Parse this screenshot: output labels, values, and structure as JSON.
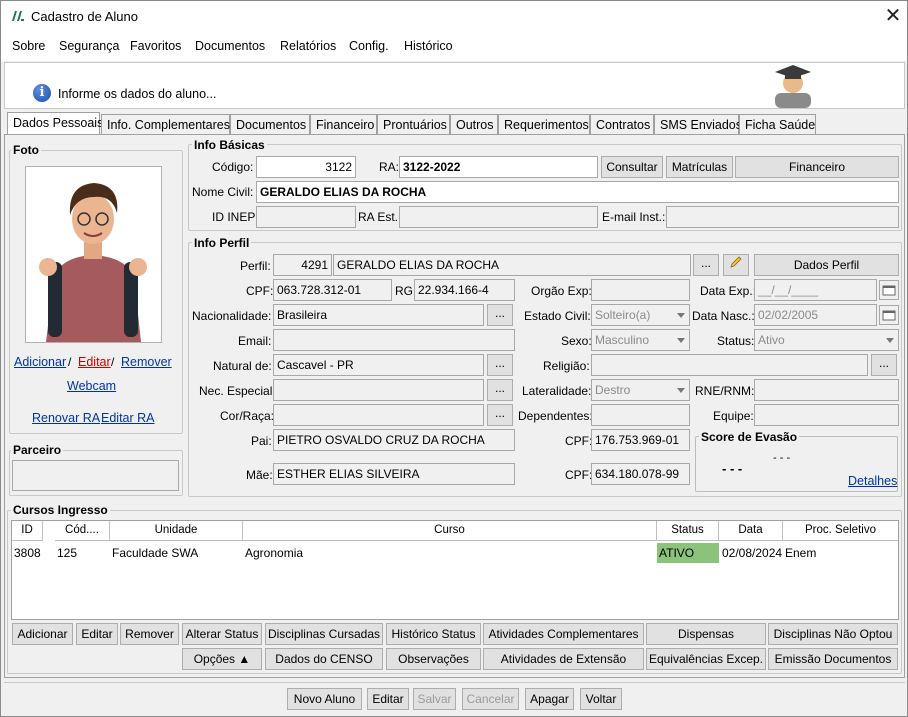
{
  "window": {
    "title": "Cadastro de Aluno"
  },
  "menu": [
    "Sobre",
    "Segurança",
    "Favoritos",
    "Documentos",
    "Relatórios",
    "Config.",
    "Histórico"
  ],
  "info_message": "Informe os dados do aluno...",
  "tabs": [
    "Dados Pessoais",
    "Info. Complementares",
    "Documentos",
    "Financeiro",
    "Prontuários",
    "Outros",
    "Requerimentos",
    "Contratos",
    "SMS Enviados",
    "Ficha Saúde"
  ],
  "foto": {
    "label": "Foto",
    "adicionar": "Adicionar",
    "editar": "Editar",
    "remover": "Remover",
    "sep": "/",
    "webcam": "Webcam",
    "renovar_ra": "Renovar RA",
    "editar_ra": "Editar RA"
  },
  "parceiro": {
    "label": "Parceiro"
  },
  "info_basicas": {
    "label": "Info Básicas",
    "codigo_label": "Código:",
    "codigo": "3122",
    "ra_label": "RA:",
    "ra": "3122-2022",
    "consultar": "Consultar",
    "matriculas": "Matrículas",
    "financeiro": "Financeiro",
    "nome_label": "Nome Civil:",
    "nome": "GERALDO ELIAS DA ROCHA",
    "inep_label": "ID INEP:",
    "ra_est_label": "RA Est.:",
    "email_inst_label": "E-mail Inst.:"
  },
  "info_perfil": {
    "label": "Info Perfil",
    "perfil_label": "Perfil:",
    "perfil_id": "4291",
    "perfil_nome": "GERALDO ELIAS DA ROCHA",
    "dados_perfil": "Dados Perfil",
    "cpf_label": "CPF:",
    "cpf": "063.728.312-01",
    "rg_label": "RG:",
    "rg": "22.934.166-4",
    "orgao_label": "Orgão Exp:",
    "data_exp_label": "Data Exp.:",
    "data_exp": "__/__/____",
    "nac_label": "Nacionalidade:",
    "nac": "Brasileira",
    "estado_civil_label": "Estado Civil:",
    "estado_civil": "Solteiro(a)",
    "data_nasc_label": "Data Nasc.:",
    "data_nasc": "02/02/2005",
    "email_label": "Email:",
    "sexo_label": "Sexo:",
    "sexo": "Masculino",
    "status_label": "Status:",
    "status": "Ativo",
    "natural_label": "Natural de:",
    "natural": "Cascavel - PR",
    "religiao_label": "Religião:",
    "nec_label": "Nec. Especial:",
    "lat_label": "Lateralidade:",
    "lat": "Destro",
    "rne_label": "RNE/RNM:",
    "cor_label": "Cor/Raça:",
    "dep_label": "Dependentes:",
    "equipe_label": "Equipe:",
    "pai_label": "Pai:",
    "pai": "PIETRO OSVALDO CRUZ DA ROCHA",
    "pai_cpf_label": "CPF:",
    "pai_cpf": "176.753.969-01",
    "mae_label": "Mãe:",
    "mae": "ESTHER ELIAS SILVEIRA",
    "mae_cpf_label": "CPF:",
    "mae_cpf": "634.180.078-99",
    "dots": "...",
    "score": {
      "label": "Score de Evasão",
      "value1": "- - -",
      "value2": "- - -",
      "detalhes": "Detalhes"
    }
  },
  "cursos": {
    "label": "Cursos Ingresso",
    "columns": [
      "ID",
      "Cód....",
      "Unidade",
      "Curso",
      "Status",
      "Data",
      "Proc. Seletivo"
    ],
    "row": {
      "id": "3808",
      "cod": "125",
      "unidade": "Faculdade SWA",
      "curso": "Agronomia",
      "status": "ATIVO",
      "data": "02/08/2024",
      "proc": "Enem"
    },
    "status_color": "#8cc37a"
  },
  "curso_buttons1": [
    "Adicionar",
    "Editar",
    "Remover",
    "Alterar Status",
    "Disciplinas Cursadas",
    "Histórico Status",
    "Atividades Complementares",
    "Dispensas",
    "Disciplinas Não Optou"
  ],
  "curso_buttons2": [
    "Opções",
    "Dados do CENSO",
    "Observações",
    "Atividades de Extensão",
    "Equivalências Excep.",
    "Emissão Documentos"
  ],
  "footer": [
    "Novo Aluno",
    "Editar",
    "Salvar",
    "Cancelar",
    "Apagar",
    "Voltar"
  ]
}
